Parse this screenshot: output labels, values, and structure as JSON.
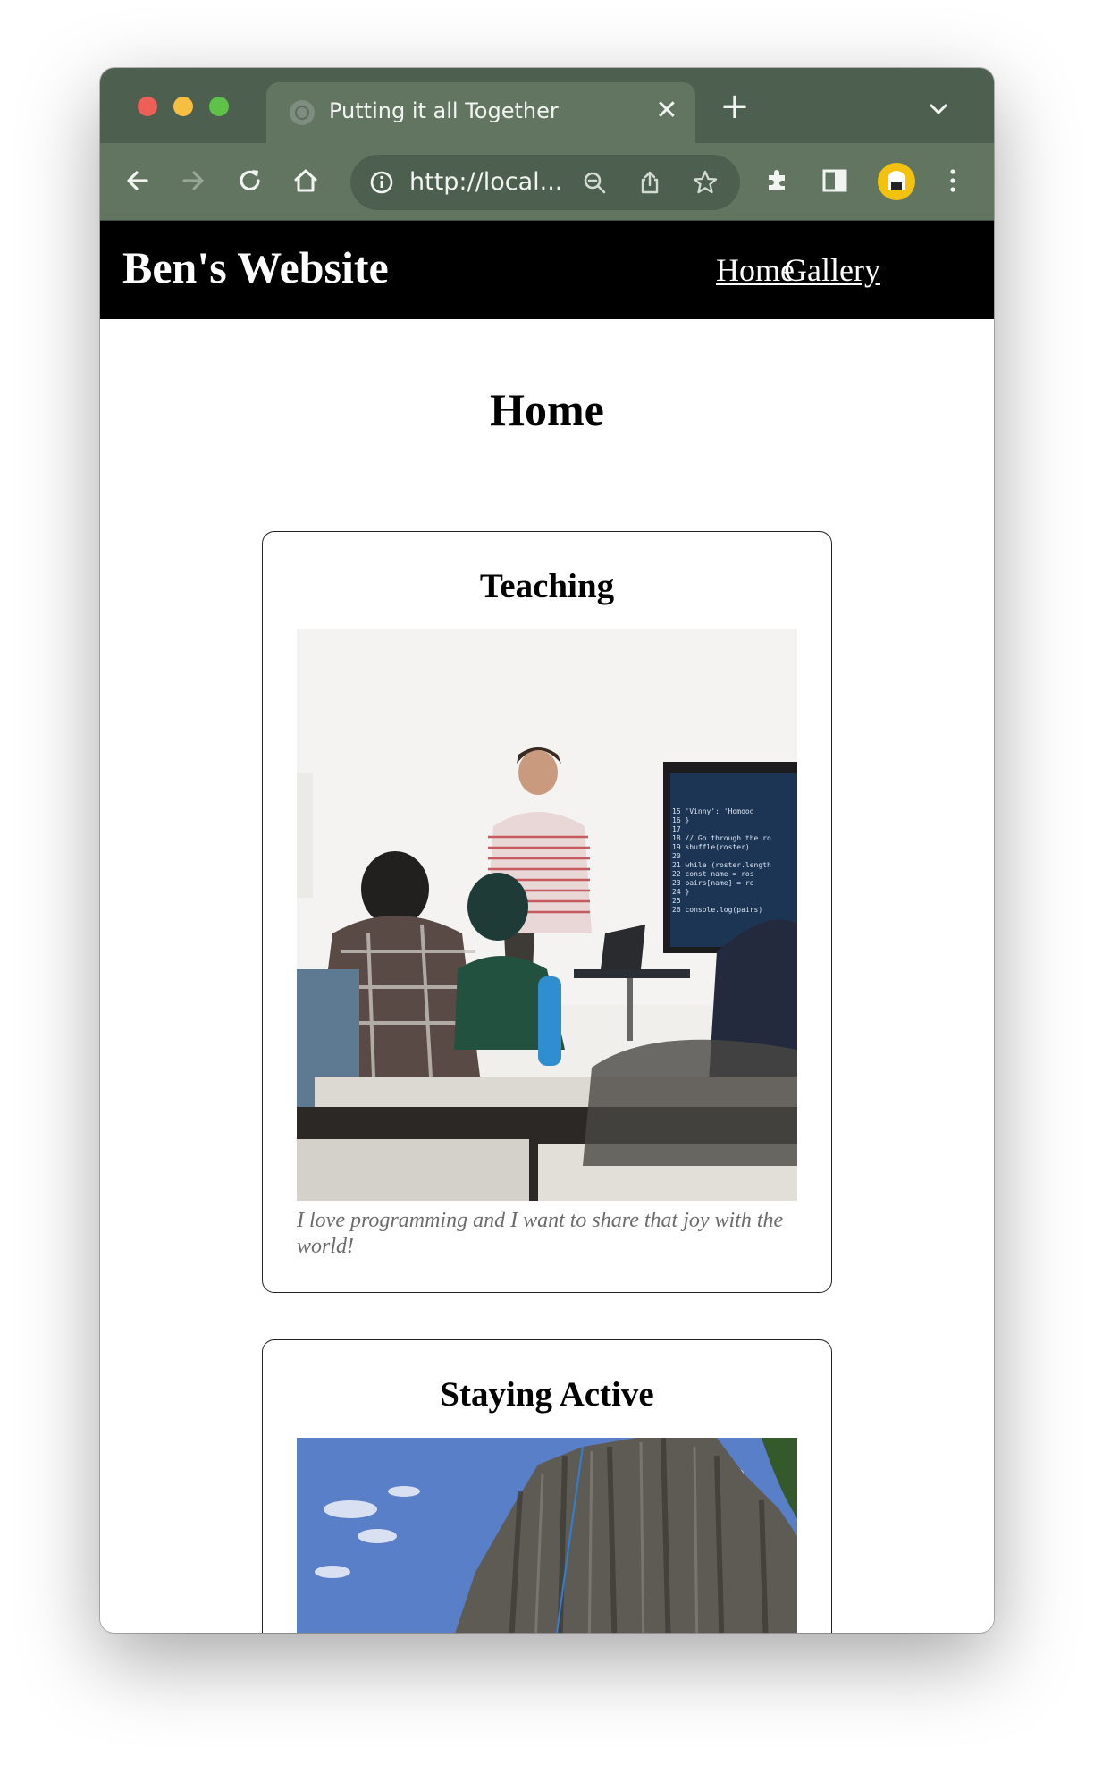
{
  "browser": {
    "tab_title": "Putting it all Together",
    "tab_close": "✕",
    "new_tab": "+",
    "url": "http://local..."
  },
  "site": {
    "title": "Ben's Website",
    "nav": [
      {
        "label": "Home"
      },
      {
        "label": "Gallery"
      }
    ]
  },
  "page": {
    "heading": "Home"
  },
  "cards": [
    {
      "title": "Teaching",
      "caption": "I love programming and I want to share that joy with the world!",
      "screen_code": [
        "15  'Vinny': 'Homood",
        "16 }",
        "17",
        "18 // Go through the ro",
        "19 shuffle(roster)",
        "20",
        "21 while (roster.length",
        "22   const name = ros",
        "23   pairs[name] = ro",
        "24 }",
        "25",
        "26 console.log(pairs)"
      ]
    },
    {
      "title": "Staying Active",
      "caption": ""
    }
  ],
  "icons": {
    "back": "arrow-left-icon",
    "forward": "arrow-right-icon",
    "reload": "reload-icon",
    "home": "home-icon",
    "info": "info-icon",
    "zoom": "zoom-out-icon",
    "share": "share-icon",
    "bookmark": "star-icon",
    "extensions": "puzzle-icon",
    "sidepanel": "side-panel-icon",
    "menu": "kebab-menu-icon"
  },
  "colors": {
    "frame": "#4d5f4f",
    "toolbar": "#627561",
    "header_bg": "#000000",
    "caption": "#6b6b6b"
  }
}
